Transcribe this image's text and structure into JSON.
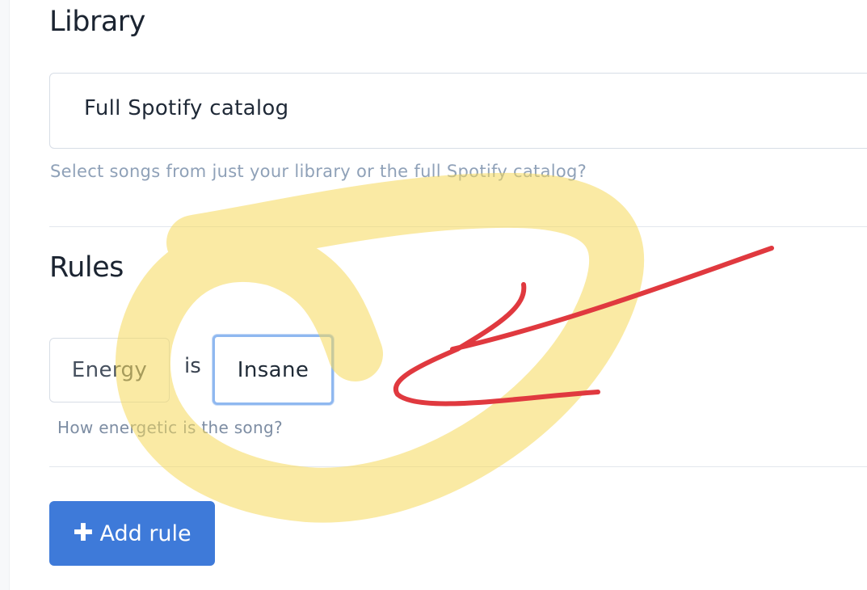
{
  "library": {
    "title": "Library",
    "selected_value": "Full Spotify catalog",
    "help": "Select songs from just your library or the full Spotify catalog?"
  },
  "rules": {
    "title": "Rules",
    "rule": {
      "field": "Energy",
      "operator": "is",
      "value": "Insane",
      "help": "How energetic is the song?"
    },
    "add_button_label": "Add rule",
    "add_button_icon": "plus-icon"
  },
  "colors": {
    "button": "#3e7ad9",
    "highlighter": "#f5d85a",
    "pen": "#e0393f",
    "focus_ring": "#8fb8f0"
  }
}
